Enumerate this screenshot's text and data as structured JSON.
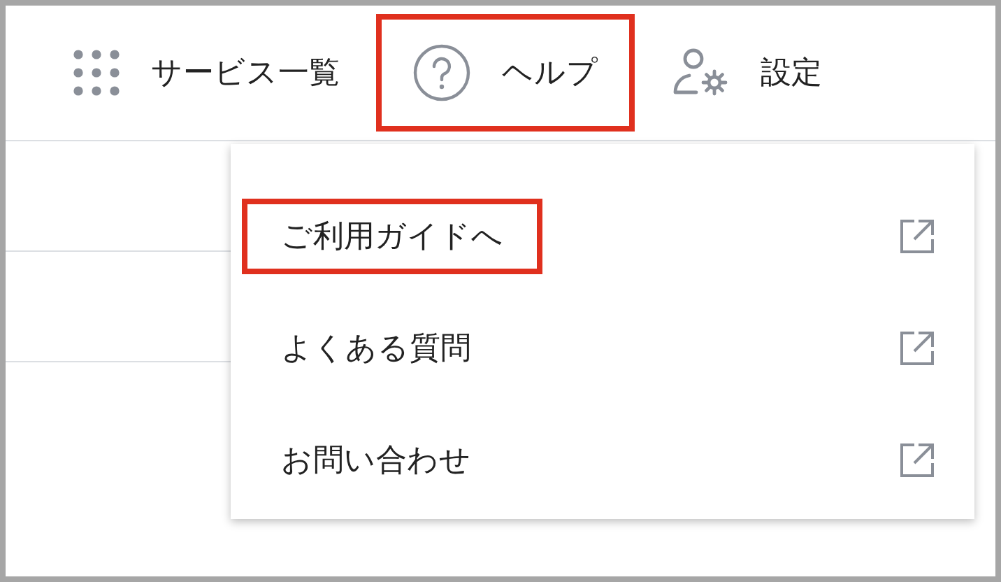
{
  "nav": [
    {
      "kind": "grid",
      "label": "サービス一覧",
      "highlighted": false
    },
    {
      "kind": "help",
      "label": "ヘルプ",
      "highlighted": true
    },
    {
      "kind": "settings",
      "label": "設定",
      "highlighted": false
    }
  ],
  "help_menu": {
    "items": [
      {
        "label": "ご利用ガイドへ",
        "highlighted": true
      },
      {
        "label": "よくある質問",
        "highlighted": false
      },
      {
        "label": "お問い合わせ",
        "highlighted": false
      }
    ]
  }
}
